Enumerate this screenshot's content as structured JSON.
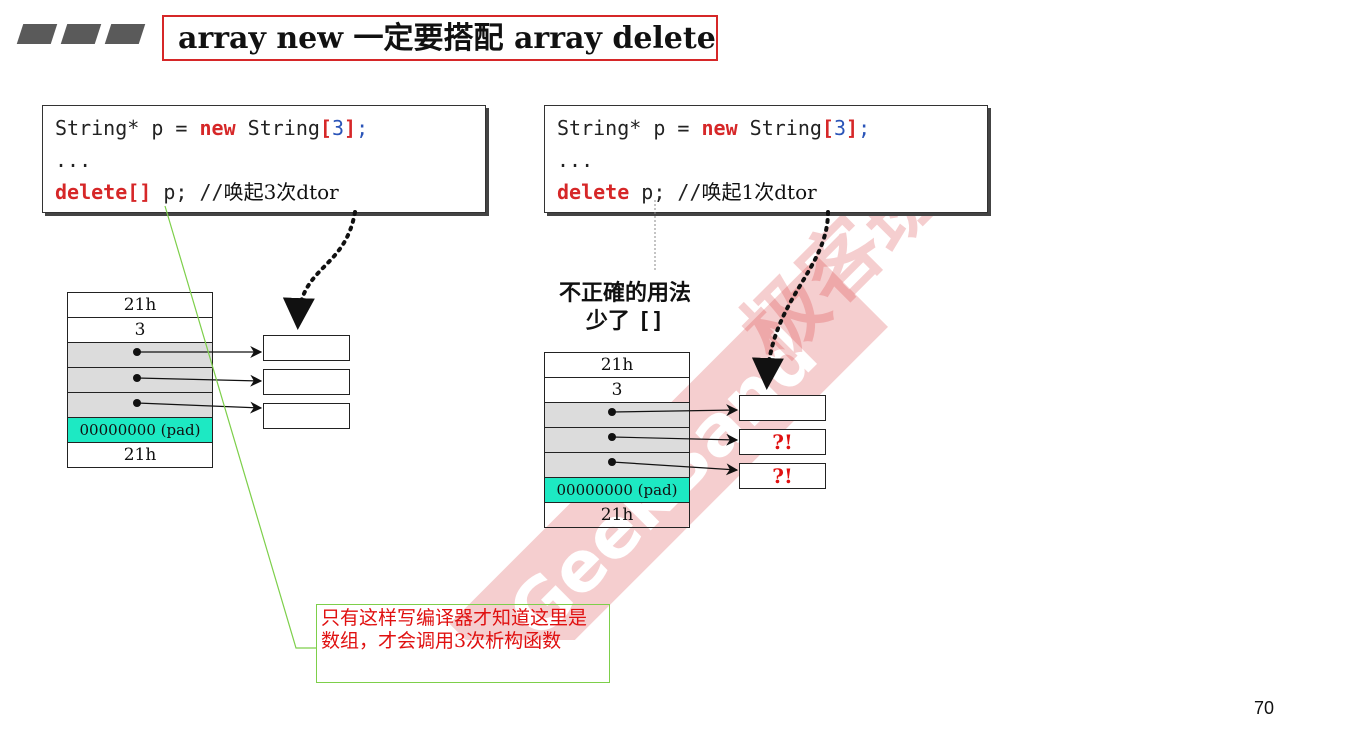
{
  "title": "array new 一定要搭配 array delete",
  "left": {
    "code_line1": {
      "a": "String* p = ",
      "kw": "new",
      "b": " String",
      "lb": "[",
      "n": "3",
      "rb": "]",
      "c": ";"
    },
    "code_line2": "...",
    "code_line3": {
      "kw": "delete[]",
      "b": " p;  //",
      "comment": "唤起3次dtor"
    },
    "memory": [
      "21h",
      "3",
      "",
      "",
      "",
      "00000000 (pad)",
      "21h"
    ]
  },
  "right": {
    "code_line1": {
      "a": "String* p = ",
      "kw": "new",
      "b": " String",
      "lb": "[",
      "n": "3",
      "rb": "]",
      "c": ";"
    },
    "code_line2": "...",
    "code_line3": {
      "kw": "delete",
      "b": " p;  //",
      "comment": "唤起1次dtor"
    },
    "wrong_line1": "不正確的用法",
    "wrong_line2_a": "少了 ",
    "wrong_line2_b": "[]",
    "memory": [
      "21h",
      "3",
      "",
      "",
      "",
      "00000000 (pad)",
      "21h"
    ],
    "object_labels": [
      "",
      "?!",
      "?!"
    ]
  },
  "note": "只有这样写编译器才知道这里是数组，才会调用3次析构函数",
  "page_number": "70",
  "watermark": {
    "text_cn": "极客班",
    "text_en": "GeekBand"
  },
  "colors": {
    "accent_red": "#d62728",
    "pad_teal": "#1de9c3",
    "note_green": "#7dcf4a"
  }
}
